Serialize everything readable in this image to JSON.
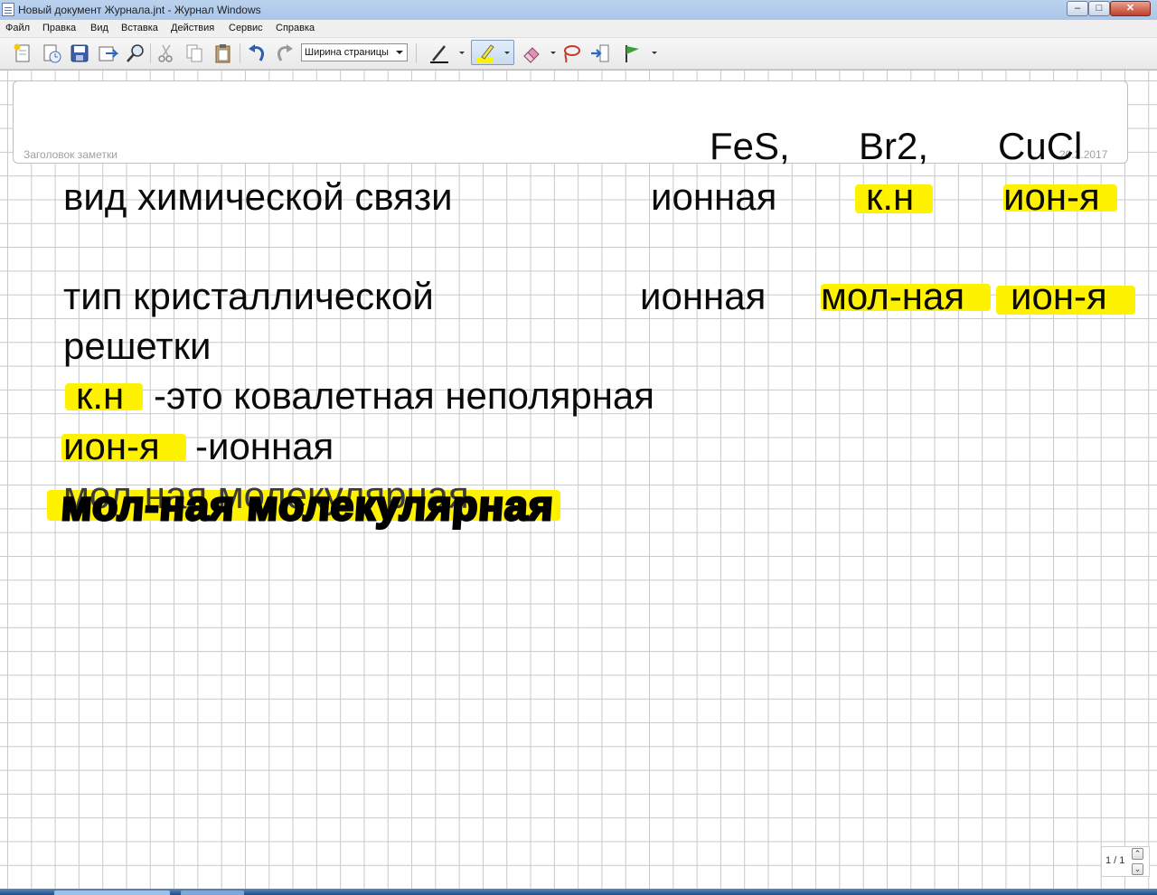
{
  "window": {
    "title": "Новый документ Журнала.jnt - Журнал Windows",
    "controls": {
      "minimize": "–",
      "maximize": "□",
      "close": "✕"
    }
  },
  "menu": [
    "Файл",
    "Правка",
    "Вид",
    "Вставка",
    "Действия",
    "Сервис",
    "Справка"
  ],
  "toolbar": {
    "zoom_value": "Ширина страницы",
    "icons": [
      "new-note-icon",
      "new-note-from-template-icon",
      "save-icon",
      "send-icon",
      "find-icon",
      "cut-icon",
      "copy-icon",
      "paste-icon",
      "undo-icon",
      "redo-icon",
      "pen-icon",
      "highlighter-icon",
      "eraser-icon",
      "lasso-select-icon",
      "insert-space-icon",
      "flag-icon"
    ]
  },
  "note": {
    "title_placeholder": "Заголовок заметки",
    "date": "20.2.2017",
    "columns": [
      "FeS,",
      "Br2,",
      "CuCl"
    ],
    "row1": {
      "label": "вид химической связи",
      "v1": "ионная",
      "v2": "к.н",
      "v3": "ион-я"
    },
    "row2": {
      "label": "тип кристаллической",
      "label2": "решетки",
      "v1": "ионная",
      "v2": "мол-ная",
      "v3": "ион-я"
    },
    "legend": [
      {
        "abbr": "к.н",
        "text": "-это ковалетная неполярная"
      },
      {
        "abbr": "ион-я",
        "text": "-ионная"
      },
      {
        "abbr": "мол-ная",
        "text": "молекулярная"
      }
    ],
    "scribble": "мол-ная молекулярная",
    "highlight_color": "#fff200"
  },
  "pager": {
    "label": "1 / 1",
    "up": "⌃",
    "down": "⌄"
  }
}
